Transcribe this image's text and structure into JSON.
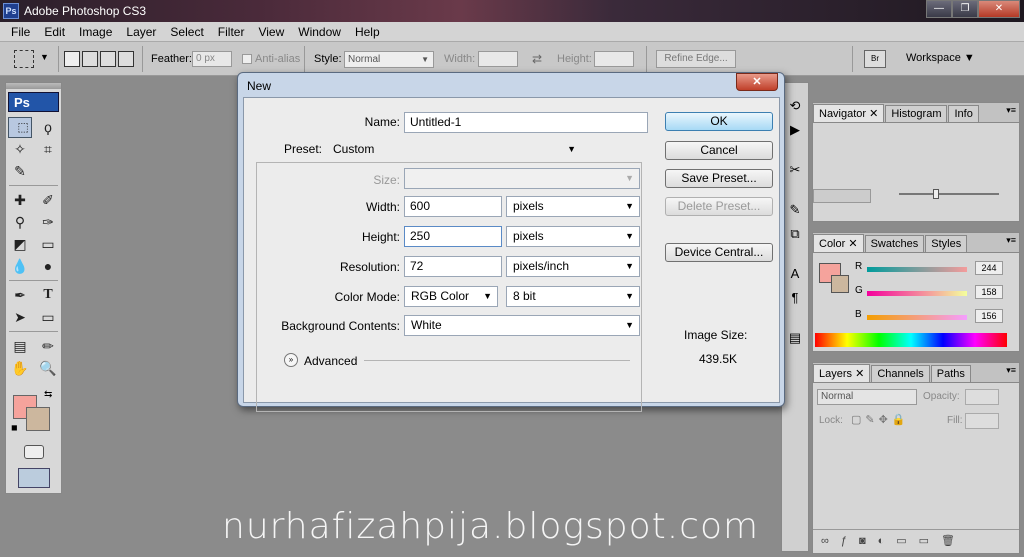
{
  "app": {
    "title": "Adobe Photoshop CS3",
    "logo": "Ps"
  },
  "menu": [
    "File",
    "Edit",
    "Image",
    "Layer",
    "Select",
    "Filter",
    "View",
    "Window",
    "Help"
  ],
  "options": {
    "feather_label": "Feather:",
    "feather_value": "0 px",
    "antialias_label": "Anti-alias",
    "style_label": "Style:",
    "style_value": "Normal",
    "width_label": "Width:",
    "height_label": "Height:",
    "refine_label": "Refine Edge...",
    "workspace_label": "Workspace"
  },
  "dialog": {
    "title": "New",
    "name_label": "Name:",
    "name_value": "Untitled-1",
    "preset_label": "Preset:",
    "preset_value": "Custom",
    "size_label": "Size:",
    "width_label": "Width:",
    "width_value": "600",
    "width_unit": "pixels",
    "height_label": "Height:",
    "height_value": "250",
    "height_unit": "pixels",
    "resolution_label": "Resolution:",
    "resolution_value": "72",
    "resolution_unit": "pixels/inch",
    "colormode_label": "Color Mode:",
    "colormode_value": "RGB Color",
    "bitdepth_value": "8 bit",
    "bg_label": "Background Contents:",
    "bg_value": "White",
    "advanced_label": "Advanced",
    "ok": "OK",
    "cancel": "Cancel",
    "save_preset": "Save Preset...",
    "delete_preset": "Delete Preset...",
    "device_central": "Device Central...",
    "image_size_label": "Image Size:",
    "image_size_value": "439.5K"
  },
  "panels": {
    "nav_tabs": [
      "Navigator",
      "Histogram",
      "Info"
    ],
    "color_tabs": [
      "Color",
      "Swatches",
      "Styles"
    ],
    "color": {
      "r_label": "R",
      "r_value": "244",
      "g_label": "G",
      "g_value": "158",
      "b_label": "B",
      "b_value": "156",
      "fg": "#f5a39c",
      "bg": "#ccb79e"
    },
    "layer_tabs": [
      "Layers",
      "Channels",
      "Paths"
    ],
    "layers": {
      "blend": "Normal",
      "opacity_label": "Opacity:",
      "lock_label": "Lock:",
      "fill_label": "Fill:"
    }
  },
  "toolbox": {
    "fg": "#f5a39c",
    "bg": "#ccb79e"
  },
  "watermark": "nurhafizahpija.blogspot.com"
}
